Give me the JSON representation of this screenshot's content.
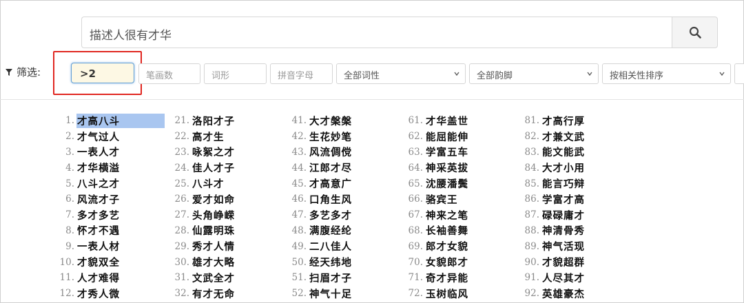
{
  "search": {
    "query": "描述人很有才华"
  },
  "filters": {
    "label": "筛选:",
    "word_count_value": ">2",
    "stroke_placeholder": "笔画数",
    "shape_placeholder": "词形",
    "pinyin_placeholder": "拼音字母",
    "pos_select": "全部词性",
    "rhyme_select": "全部韵脚",
    "sort_select": "按相关性排序"
  },
  "results": {
    "selected_index": 1,
    "columns": [
      [
        {
          "n": "1.",
          "w": "才高八斗"
        },
        {
          "n": "2.",
          "w": "才气过人"
        },
        {
          "n": "3.",
          "w": "一表人才"
        },
        {
          "n": "4.",
          "w": "才华横溢"
        },
        {
          "n": "5.",
          "w": "八斗之才"
        },
        {
          "n": "6.",
          "w": "风流才子"
        },
        {
          "n": "7.",
          "w": "多才多艺"
        },
        {
          "n": "8.",
          "w": "怀才不遇"
        },
        {
          "n": "9.",
          "w": "一表人材"
        },
        {
          "n": "10.",
          "w": "才貌双全"
        },
        {
          "n": "11.",
          "w": "人才难得"
        },
        {
          "n": "12.",
          "w": "才秀人微"
        }
      ],
      [
        {
          "n": "21.",
          "w": "洛阳才子"
        },
        {
          "n": "22.",
          "w": "高才生"
        },
        {
          "n": "23.",
          "w": "咏絮之才"
        },
        {
          "n": "24.",
          "w": "佳人才子"
        },
        {
          "n": "25.",
          "w": "八斗才"
        },
        {
          "n": "26.",
          "w": "爱才如命"
        },
        {
          "n": "27.",
          "w": "头角峥嵘"
        },
        {
          "n": "28.",
          "w": "仙露明珠"
        },
        {
          "n": "29.",
          "w": "秀才人情"
        },
        {
          "n": "30.",
          "w": "雄才大略"
        },
        {
          "n": "31.",
          "w": "文武全才"
        },
        {
          "n": "32.",
          "w": "有才无命"
        }
      ],
      [
        {
          "n": "41.",
          "w": "大才槃槃"
        },
        {
          "n": "42.",
          "w": "生花妙笔"
        },
        {
          "n": "43.",
          "w": "风流倜傥"
        },
        {
          "n": "44.",
          "w": "江郎才尽"
        },
        {
          "n": "45.",
          "w": "才高意广"
        },
        {
          "n": "46.",
          "w": "口角生风"
        },
        {
          "n": "47.",
          "w": "多艺多才"
        },
        {
          "n": "48.",
          "w": "满腹经纶"
        },
        {
          "n": "49.",
          "w": "二八佳人"
        },
        {
          "n": "50.",
          "w": "经天纬地"
        },
        {
          "n": "51.",
          "w": "扫眉才子"
        },
        {
          "n": "52.",
          "w": "神气十足"
        }
      ],
      [
        {
          "n": "61.",
          "w": "才华盖世"
        },
        {
          "n": "62.",
          "w": "能屈能伸"
        },
        {
          "n": "63.",
          "w": "学富五车"
        },
        {
          "n": "64.",
          "w": "神采英拔"
        },
        {
          "n": "65.",
          "w": "沈腰潘鬓"
        },
        {
          "n": "66.",
          "w": "骆宾王"
        },
        {
          "n": "67.",
          "w": "神来之笔"
        },
        {
          "n": "68.",
          "w": "长袖善舞"
        },
        {
          "n": "69.",
          "w": "郎才女貌"
        },
        {
          "n": "70.",
          "w": "女貌郎才"
        },
        {
          "n": "71.",
          "w": "奇才异能"
        },
        {
          "n": "72.",
          "w": "玉树临风"
        }
      ],
      [
        {
          "n": "81.",
          "w": "才高行厚"
        },
        {
          "n": "82.",
          "w": "才兼文武"
        },
        {
          "n": "83.",
          "w": "能文能武"
        },
        {
          "n": "84.",
          "w": "大才小用"
        },
        {
          "n": "85.",
          "w": "能言巧辩"
        },
        {
          "n": "86.",
          "w": "学富才高"
        },
        {
          "n": "87.",
          "w": "碌碌庸才"
        },
        {
          "n": "88.",
          "w": "神清骨秀"
        },
        {
          "n": "89.",
          "w": "神气活现"
        },
        {
          "n": "90.",
          "w": "才貌超群"
        },
        {
          "n": "91.",
          "w": "人尽其才"
        },
        {
          "n": "92.",
          "w": "英雄豪杰"
        }
      ]
    ]
  },
  "colors": {
    "highlight_border": "#e0251f",
    "selection": "#a9c6f0",
    "focus_border": "#5b9bd5"
  }
}
